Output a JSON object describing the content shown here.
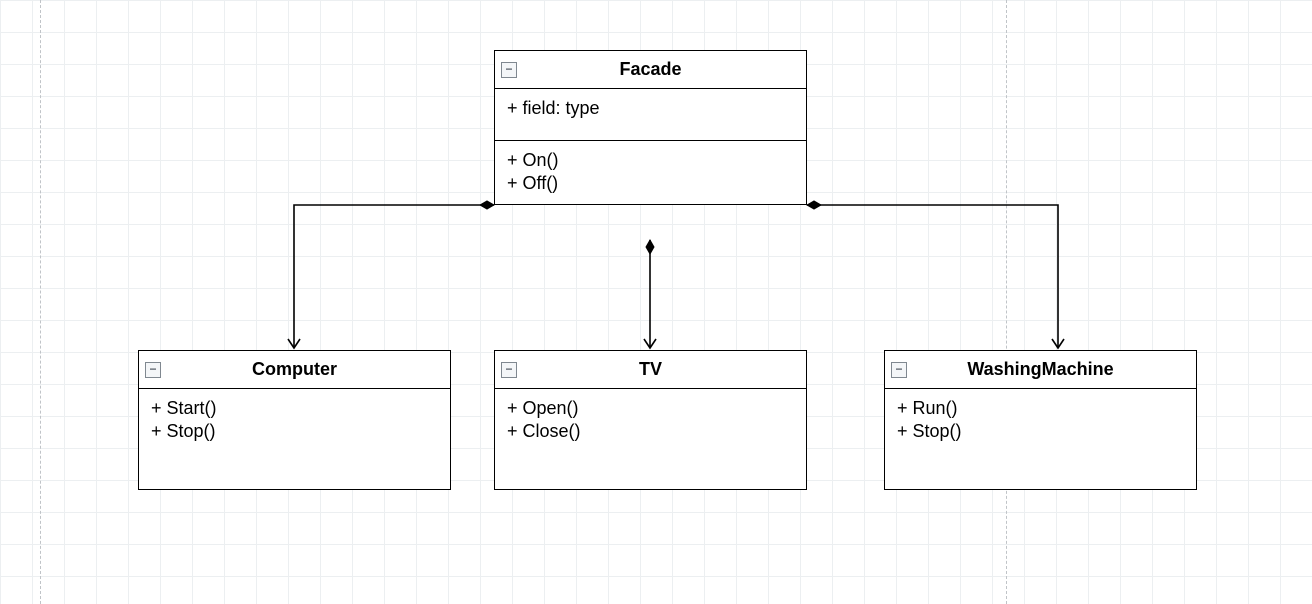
{
  "classes": {
    "facade": {
      "name": "Facade",
      "fields": "+ field: type",
      "methods": "+ On()\n+ Off()"
    },
    "computer": {
      "name": "Computer",
      "methods": "+ Start()\n+ Stop()"
    },
    "tv": {
      "name": "TV",
      "methods": "+ Open()\n+ Close()"
    },
    "washing": {
      "name": "WashingMachine",
      "methods": "+ Run()\n+ Stop()"
    }
  }
}
